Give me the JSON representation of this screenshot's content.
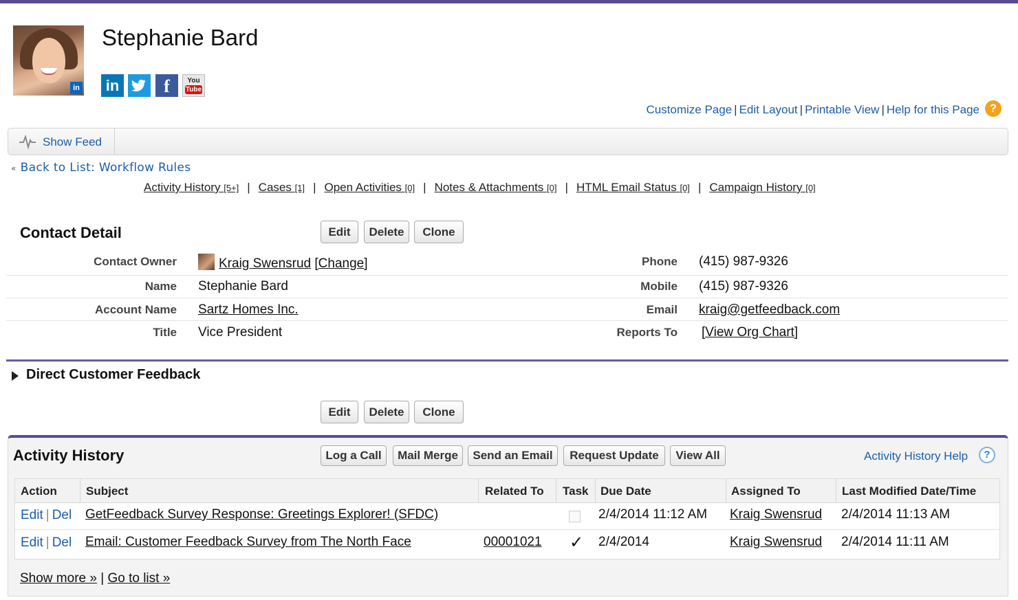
{
  "header": {
    "name": "Stephanie Bard",
    "avatar_badge": "in",
    "social": {
      "linkedin": "in",
      "facebook": "f",
      "youtube_top": "You",
      "youtube_bottom": "Tube"
    }
  },
  "top_links": {
    "customize": "Customize Page",
    "edit_layout": "Edit Layout",
    "printable": "Printable View",
    "help": "Help for this Page",
    "separator": "|",
    "help_icon": "?"
  },
  "feed": {
    "label": "Show Feed"
  },
  "back_link": {
    "chevron": "«",
    "label": "Back to List: Workflow Rules"
  },
  "related_lists": [
    {
      "label": "Activity History",
      "count": "[5+]"
    },
    {
      "label": "Cases",
      "count": "[1]"
    },
    {
      "label": "Open Activities",
      "count": "[0]"
    },
    {
      "label": "Notes & Attachments",
      "count": "[0]"
    },
    {
      "label": "HTML Email Status",
      "count": "[0]"
    },
    {
      "label": "Campaign History",
      "count": "[0]"
    }
  ],
  "related_separator": "|",
  "contact_detail": {
    "title": "Contact Detail",
    "buttons": {
      "edit": "Edit",
      "delete": "Delete",
      "clone": "Clone"
    },
    "left": [
      {
        "label": "Contact Owner",
        "value": "Kraig Swensrud",
        "extra": "[Change]"
      },
      {
        "label": "Name",
        "value": "Stephanie Bard"
      },
      {
        "label": "Account Name",
        "value": "Sartz Homes Inc."
      },
      {
        "label": "Title",
        "value": "Vice President"
      }
    ],
    "right": [
      {
        "label": "Phone",
        "value": "(415) 987-9326"
      },
      {
        "label": "Mobile",
        "value": "(415) 987-9326"
      },
      {
        "label": "Email",
        "value": "kraig@getfeedback.com"
      },
      {
        "label": "Reports To",
        "value": "[View Org Chart]"
      }
    ]
  },
  "feedback_section": {
    "title": "Direct Customer Feedback"
  },
  "bottom_buttons": {
    "edit": "Edit",
    "delete": "Delete",
    "clone": "Clone"
  },
  "activity_history": {
    "title": "Activity History",
    "buttons": [
      "Log a Call",
      "Mail Merge",
      "Send an Email",
      "Request Update",
      "View All"
    ],
    "help": "Activity History Help",
    "help_icon": "?",
    "columns": [
      "Action",
      "Subject",
      "Related To",
      "Task",
      "Due Date",
      "Assigned To",
      "Last Modified Date/Time"
    ],
    "rows": [
      {
        "edit": "Edit",
        "del": "Del",
        "sep": "|",
        "subject": "GetFeedback Survey Response: Greetings Explorer! (SFDC)",
        "related_to": "",
        "task": false,
        "due_date": "2/4/2014 11:12 AM",
        "assigned_to": "Kraig Swensrud",
        "last_modified": "2/4/2014 11:13 AM"
      },
      {
        "edit": "Edit",
        "del": "Del",
        "sep": "|",
        "subject": "Email: Customer Feedback Survey from The North Face",
        "related_to": "00001021",
        "task": true,
        "task_mark": "✓",
        "due_date": "2/4/2014",
        "assigned_to": "Kraig Swensrud",
        "last_modified": "2/4/2014 11:11 AM"
      }
    ],
    "show_more": "Show more »",
    "footer_sep": "|",
    "go_to_list": "Go to list »"
  },
  "colors": {
    "accent_purple": "#5a4a96",
    "link_blue": "#1b5ea8",
    "help_orange": "#f2a31c"
  }
}
